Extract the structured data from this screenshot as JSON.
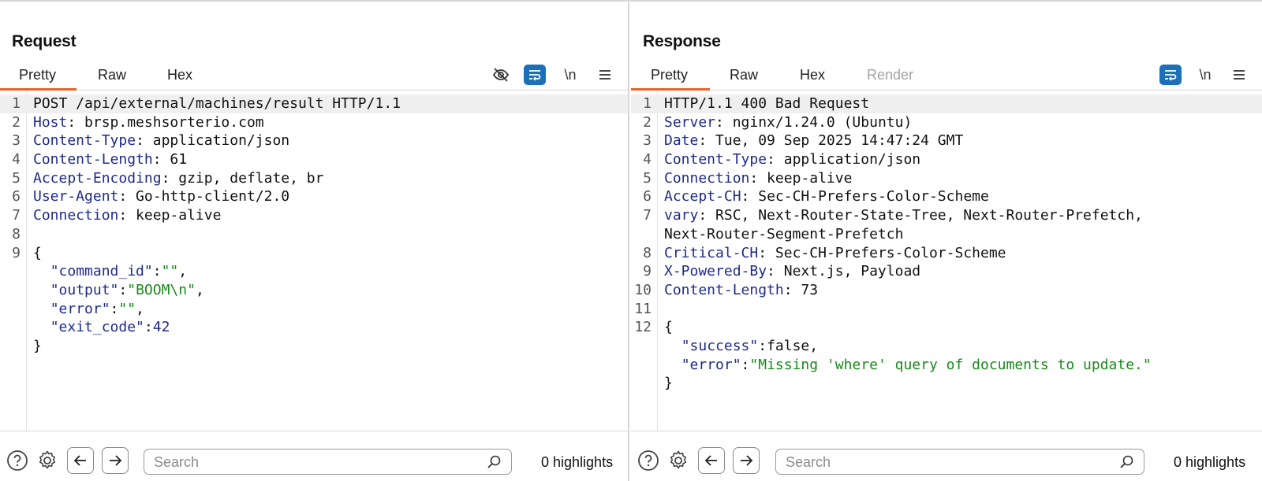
{
  "request": {
    "title": "Request",
    "tabs": [
      {
        "label": "Pretty",
        "active": true
      },
      {
        "label": "Raw"
      },
      {
        "label": "Hex"
      }
    ],
    "toolbar_icons": [
      "eye-slash-icon",
      "wrap-lines-icon",
      "newline-icon",
      "menu-icon"
    ],
    "newline_label": "\\n",
    "lines": [
      {
        "num": "1",
        "text": "POST /api/external/machines/result HTTP/1.1"
      },
      {
        "num": "2",
        "key": "Host",
        "value": " brsp.meshsorterio.com"
      },
      {
        "num": "3",
        "key": "Content-Type",
        "value": " application/json"
      },
      {
        "num": "4",
        "key": "Content-Length",
        "value": " 61"
      },
      {
        "num": "5",
        "key": "Accept-Encoding",
        "value": " gzip, deflate, br"
      },
      {
        "num": "6",
        "key": "User-Agent",
        "value": " Go-http-client/2.0"
      },
      {
        "num": "7",
        "key": "Connection",
        "value": " keep-alive"
      },
      {
        "num": "8",
        "text": ""
      },
      {
        "num": "9",
        "text": "{"
      },
      {
        "num": "",
        "indent": "  ",
        "jkey": "\"command_id\"",
        "jval": "\"\"",
        "jval_type": "string",
        "tail": ","
      },
      {
        "num": "",
        "indent": "  ",
        "jkey": "\"output\"",
        "jval": "\"BOOM\\n\"",
        "jval_type": "string",
        "tail": ","
      },
      {
        "num": "",
        "indent": "  ",
        "jkey": "\"error\"",
        "jval": "\"\"",
        "jval_type": "string",
        "tail": ","
      },
      {
        "num": "",
        "indent": "  ",
        "jkey": "\"exit_code\"",
        "jval": "42",
        "jval_type": "number",
        "tail": ""
      },
      {
        "num": "",
        "text": "}"
      }
    ],
    "search_placeholder": "Search",
    "highlights": "0 highlights"
  },
  "response": {
    "title": "Response",
    "tabs": [
      {
        "label": "Pretty",
        "active": true
      },
      {
        "label": "Raw"
      },
      {
        "label": "Hex"
      },
      {
        "label": "Render",
        "disabled": true
      }
    ],
    "toolbar_icons": [
      "wrap-lines-icon",
      "newline-icon",
      "menu-icon"
    ],
    "newline_label": "\\n",
    "lines": [
      {
        "num": "1",
        "text": "HTTP/1.1 400 Bad Request"
      },
      {
        "num": "2",
        "key": "Server",
        "value": " nginx/1.24.0 (Ubuntu)"
      },
      {
        "num": "3",
        "key": "Date",
        "value": " Tue, 09 Sep 2025 14:47:24 GMT"
      },
      {
        "num": "4",
        "key": "Content-Type",
        "value": " application/json"
      },
      {
        "num": "5",
        "key": "Connection",
        "value": " keep-alive"
      },
      {
        "num": "6",
        "key": "Accept-CH",
        "value": " Sec-CH-Prefers-Color-Scheme"
      },
      {
        "num": "7",
        "key": "vary",
        "value": " RSC, Next-Router-State-Tree, Next-Router-Prefetch,"
      },
      {
        "num": "",
        "text": "Next-Router-Segment-Prefetch"
      },
      {
        "num": "8",
        "key": "Critical-CH",
        "value": " Sec-CH-Prefers-Color-Scheme"
      },
      {
        "num": "9",
        "key": "X-Powered-By",
        "value": " Next.js, Payload"
      },
      {
        "num": "10",
        "key": "Content-Length",
        "value": " 73"
      },
      {
        "num": "11",
        "text": ""
      },
      {
        "num": "12",
        "text": "{"
      },
      {
        "num": "",
        "indent": "  ",
        "jkey": "\"success\"",
        "jval": "false",
        "jval_type": "keyword",
        "tail": ","
      },
      {
        "num": "",
        "indent": "  ",
        "jkey": "\"error\"",
        "jval": "\"Missing 'where' query of documents to update.\"",
        "jval_type": "string",
        "tail": ""
      },
      {
        "num": "",
        "text": "}"
      }
    ],
    "search_placeholder": "Search",
    "highlights": "0 highlights"
  },
  "layout_toggle": {
    "options": [
      "split-vertical-icon",
      "split-horizontal-icon",
      "single-pane-icon"
    ],
    "active": 0
  },
  "colors": {
    "accent_tab": "#e8622c",
    "toggle_blue": "#1d6fb8",
    "header_key": "#1e2a8a",
    "json_string": "#1a8a1a"
  }
}
